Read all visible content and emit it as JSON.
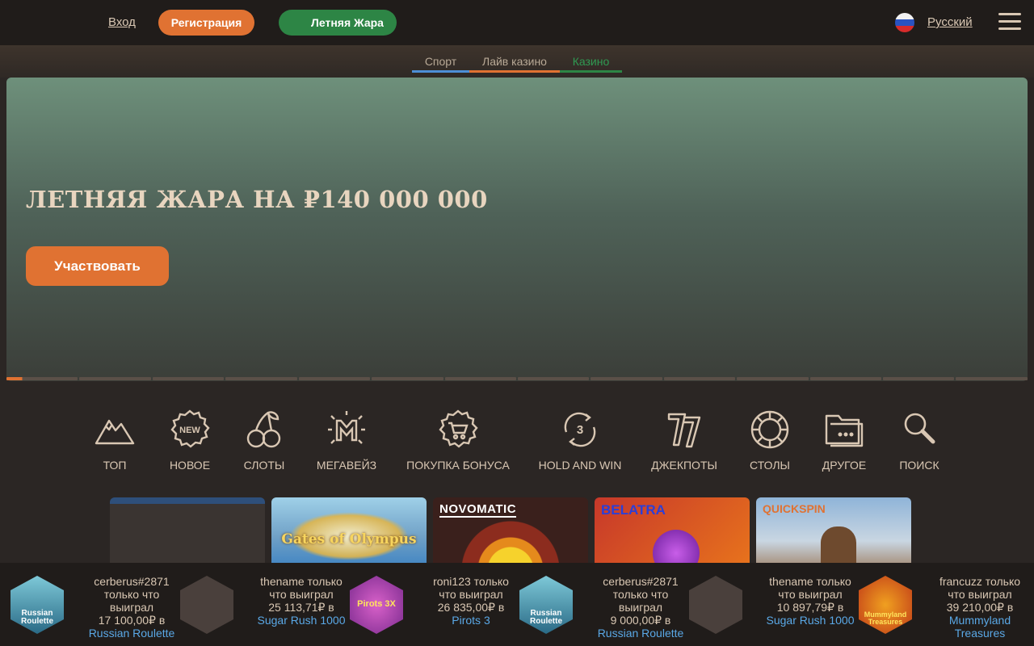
{
  "header": {
    "login": "Вход",
    "register": "Регистрация",
    "promo": "Летняя Жара",
    "language": "Русский"
  },
  "subnav": [
    {
      "label": "Спорт",
      "color": "#4d8fd6"
    },
    {
      "label": "Лайв казино",
      "color": "#e07232"
    },
    {
      "label": "Казино",
      "color": "#2d8545"
    }
  ],
  "hero": {
    "title": "ЛЕТНЯЯ ЖАРА НА ₽140 000 000",
    "button": "Участвовать",
    "slides_total": 14,
    "active_slide": 1
  },
  "categories": [
    {
      "label": "ТОП",
      "icon": "mountain-icon"
    },
    {
      "label": "НОВОЕ",
      "icon": "new-badge-icon"
    },
    {
      "label": "СЛОТЫ",
      "icon": "cherries-icon"
    },
    {
      "label": "МЕГАВЕЙЗ",
      "icon": "megaways-icon"
    },
    {
      "label": "ПОКУПКА БОНУСА",
      "icon": "shopping-cart-icon"
    },
    {
      "label": "HOLD AND WIN",
      "icon": "hold-and-win-icon"
    },
    {
      "label": "ДЖЕКПОТЫ",
      "icon": "sevens-icon"
    },
    {
      "label": "СТОЛЫ",
      "icon": "poker-chip-icon"
    },
    {
      "label": "ДРУГОЕ",
      "icon": "folder-icon"
    },
    {
      "label": "ПОИСК",
      "icon": "search-icon"
    }
  ],
  "games": [
    {
      "provider": "",
      "title": ""
    },
    {
      "provider": "",
      "title": "Gates of Olympus"
    },
    {
      "provider": "NOVOMATIC",
      "title": ""
    },
    {
      "provider": "BELATRA",
      "title": ""
    },
    {
      "provider": "QUICKSPIN",
      "title": ""
    }
  ],
  "wins": [
    {
      "user": "cerberus#2871",
      "verb": "только что выиграл",
      "amount": "17 100,00₽ в",
      "game": "Russian Roulette",
      "thumb": "Russian Roulette"
    },
    {
      "user": "thename только",
      "verb": "что выиграл",
      "amount": "25 113,71₽ в",
      "game": "Sugar Rush 1000",
      "thumb": ""
    },
    {
      "user": "roni123 только",
      "verb": "что выиграл",
      "amount": "26 835,00₽ в",
      "game": "Pirots 3",
      "thumb": "Pirots 3X"
    },
    {
      "user": "cerberus#2871",
      "verb": "только что выиграл",
      "amount": "9 000,00₽ в",
      "game": "Russian Roulette",
      "thumb": "Russian Roulette"
    },
    {
      "user": "thename только",
      "verb": "что выиграл",
      "amount": "10 897,79₽ в",
      "game": "Sugar Rush 1000",
      "thumb": ""
    },
    {
      "user": "francuzz только",
      "verb": "что выиграл",
      "amount": "39 210,00₽ в",
      "game": "Mummyland Treasures",
      "thumb": "Mummyland Treasures"
    }
  ]
}
